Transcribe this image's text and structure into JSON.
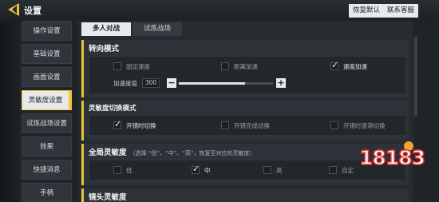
{
  "header": {
    "title": "设置",
    "restore_default": "恢复默认",
    "contact_support": "联系客服"
  },
  "sidebar": {
    "items": [
      {
        "label": "操作设置"
      },
      {
        "label": "基础设置"
      },
      {
        "label": "画面设置"
      },
      {
        "label": "灵敏度设置"
      },
      {
        "label": "试炼战场设置"
      },
      {
        "label": "效果"
      },
      {
        "label": "快捷消息"
      },
      {
        "label": "手柄"
      }
    ],
    "active_index": 3
  },
  "tabs": [
    {
      "label": "多人对战",
      "active": true
    },
    {
      "label": "试炼战场",
      "active": false
    }
  ],
  "steering": {
    "title": "转向模式",
    "options": [
      {
        "label": "固定速度",
        "checked": false
      },
      {
        "label": "距离加速",
        "checked": false
      },
      {
        "label": "速度加速",
        "checked": true
      }
    ],
    "accel_label": "加速度值",
    "accel_value": "300",
    "accel_fraction": 0.7,
    "minus": "−",
    "plus": "+"
  },
  "sens_switch": {
    "title": "灵敏度切换模式",
    "options": [
      {
        "label": "开镜时切换",
        "checked": true
      },
      {
        "label": "开镜完成切换",
        "checked": false
      },
      {
        "label": "开镜时逐渐切换",
        "checked": false
      }
    ]
  },
  "global_sens": {
    "title": "全局灵敏度",
    "hint": "（选择 “低”、“中”、“高”，恢复至对应的灵敏度）",
    "options": [
      {
        "label": "低",
        "checked": false
      },
      {
        "label": "中",
        "checked": true
      },
      {
        "label": "高",
        "checked": false
      },
      {
        "label": "自定",
        "checked": false
      }
    ]
  },
  "lens_sens": {
    "title": "镜头灵敏度"
  },
  "watermark": {
    "text": "18183"
  }
}
